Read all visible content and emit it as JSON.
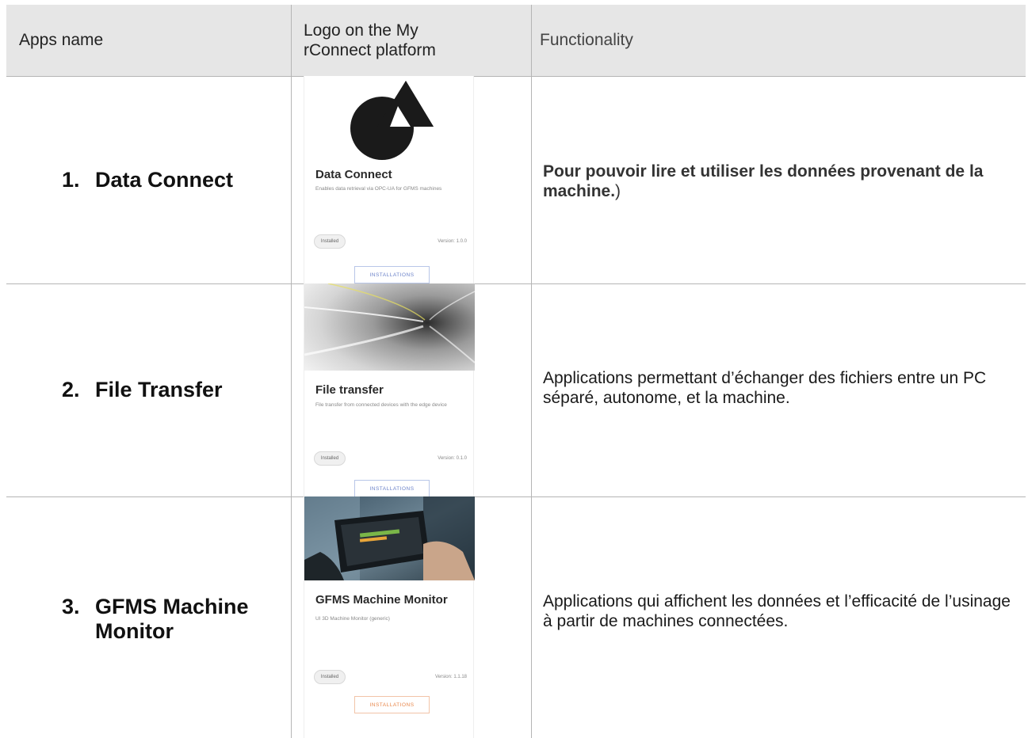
{
  "header": {
    "col1": "Apps name",
    "col2": "Logo on the My\nrConnect platform",
    "col3": "Functionality"
  },
  "rows": [
    {
      "number": "1.",
      "name": "Data Connect",
      "functionality": "Pour pouvoir lire et utiliser les données provenant de la machine.",
      "functionality_tail": ")",
      "card": {
        "title": "Data Connect",
        "description": "Enables data retrieval via OPC-UA for GFMS machines",
        "badge": "Installed",
        "version": "Version: 1.0.0",
        "button": "INSTALLATIONS"
      }
    },
    {
      "number": "2.",
      "name": "File Transfer",
      "functionality": "Applications permettant d’échanger des fichiers entre un PC séparé, autonome, et la machine.",
      "card": {
        "title": "File transfer",
        "description": "File transfer from connected devices with the edge device",
        "badge": "Installed",
        "version": "Version: 0.1.0",
        "button": "INSTALLATIONS"
      }
    },
    {
      "number": "3.",
      "name": "GFMS Machine Monitor",
      "functionality": "Applications qui affichent les données et l’efficacité de l’usinage à partir de machines connectées.",
      "card": {
        "title": "GFMS Machine Monitor",
        "description": "UI 3D Machine Monitor (generic)",
        "badge": "Installed",
        "version": "Version: 1.1.18",
        "button": "INSTALLATIONS"
      }
    }
  ],
  "colors": {
    "header_bg": "#e6e6e6",
    "grid_line": "#b5b5b5",
    "button_blue": "#6b82c9",
    "button_orange": "#e8864a"
  }
}
